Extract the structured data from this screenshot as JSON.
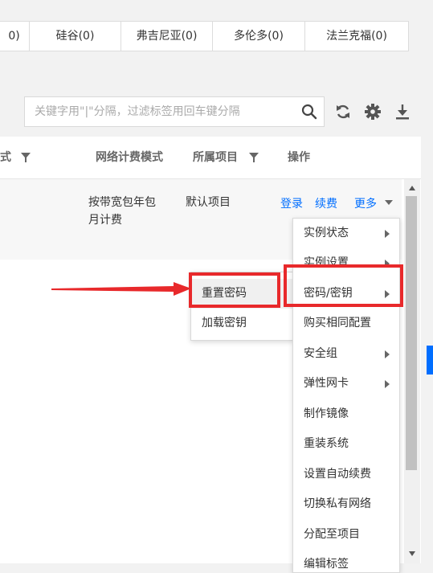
{
  "region_tabs": [
    {
      "label": "0)",
      "width": 38
    },
    {
      "label": "硅谷(0)",
      "width": 114
    },
    {
      "label": "弗吉尼亚(0)",
      "width": 114
    },
    {
      "label": "多伦多(0)",
      "width": 115
    },
    {
      "label": "法兰克福(0)",
      "width": 128
    }
  ],
  "search": {
    "placeholder": "关键字用\"|\"分隔，过滤标签用回车键分隔"
  },
  "table": {
    "headers": {
      "billing_mode_partial": "式",
      "network_billing": "网络计费模式",
      "project": "所属项目",
      "actions": "操作"
    },
    "row": {
      "network_billing_line1": "按带宽包年包",
      "network_billing_line2": "月计费",
      "project": "默认项目",
      "login": "登录",
      "renew": "续费",
      "more": "更多"
    }
  },
  "more_menu": {
    "items": [
      {
        "label": "实例状态",
        "submenu": true
      },
      {
        "label": "实例设置",
        "submenu": true
      },
      {
        "label": "密码/密钥",
        "submenu": true
      },
      {
        "label": "购买相同配置",
        "submenu": false
      },
      {
        "label": "安全组",
        "submenu": true
      },
      {
        "label": "弹性网卡",
        "submenu": true
      },
      {
        "label": "制作镜像",
        "submenu": false
      },
      {
        "label": "重装系统",
        "submenu": false
      },
      {
        "label": "设置自动续费",
        "submenu": false
      },
      {
        "label": "切换私有网络",
        "submenu": false
      },
      {
        "label": "分配至项目",
        "submenu": false
      },
      {
        "label": "编辑标签",
        "submenu": false
      }
    ]
  },
  "password_submenu": {
    "items": [
      {
        "label": "重置密码"
      },
      {
        "label": "加载密钥"
      }
    ]
  },
  "colors": {
    "accent": "#006eff",
    "highlight_red": "#e8292b"
  }
}
